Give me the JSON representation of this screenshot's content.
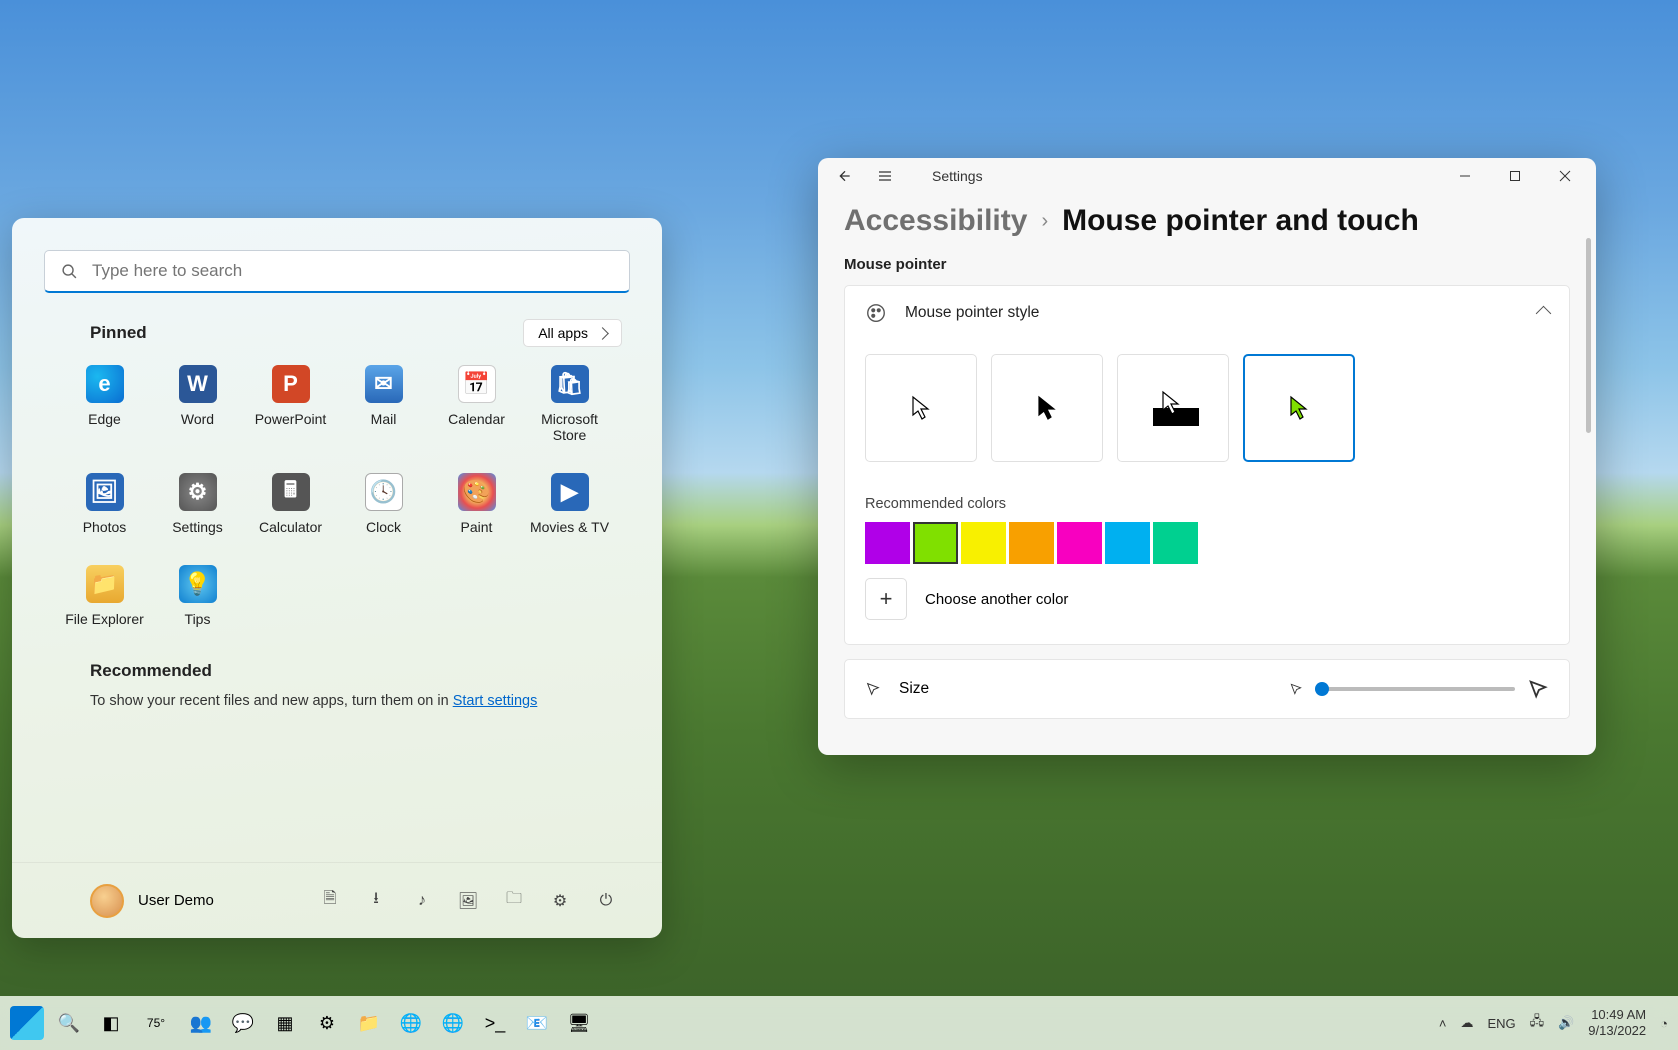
{
  "start_menu": {
    "search_placeholder": "Type here to search",
    "pinned_label": "Pinned",
    "all_apps_label": "All apps",
    "apps": [
      {
        "label": "Edge",
        "icon_class": "edge-i",
        "glyph": "e"
      },
      {
        "label": "Word",
        "icon_class": "word-i",
        "glyph": "W"
      },
      {
        "label": "PowerPoint",
        "icon_class": "ppt-i",
        "glyph": "P"
      },
      {
        "label": "Mail",
        "icon_class": "mail-i",
        "glyph": "✉"
      },
      {
        "label": "Calendar",
        "icon_class": "cal-i",
        "glyph": "📅"
      },
      {
        "label": "Microsoft Store",
        "icon_class": "store-i",
        "glyph": "🛍"
      },
      {
        "label": "Photos",
        "icon_class": "photos-i",
        "glyph": "🖼"
      },
      {
        "label": "Settings",
        "icon_class": "settings-i",
        "glyph": "⚙"
      },
      {
        "label": "Calculator",
        "icon_class": "calc-i",
        "glyph": "🖩"
      },
      {
        "label": "Clock",
        "icon_class": "clock-i",
        "glyph": "🕓"
      },
      {
        "label": "Paint",
        "icon_class": "paint-i",
        "glyph": "🎨"
      },
      {
        "label": "Movies & TV",
        "icon_class": "movies-i",
        "glyph": "▶"
      },
      {
        "label": "File Explorer",
        "icon_class": "files-i",
        "glyph": "📁"
      },
      {
        "label": "Tips",
        "icon_class": "tips-i",
        "glyph": "💡"
      }
    ],
    "recommended_label": "Recommended",
    "recommended_text": "To show your recent files and new apps, turn them on in ",
    "recommended_link": "Start settings",
    "user_name": "User Demo",
    "footer_icons": [
      "document-icon",
      "download-icon",
      "music-icon",
      "picture-icon",
      "folder-icon",
      "settings-icon",
      "power-icon"
    ]
  },
  "settings_window": {
    "app_title": "Settings",
    "breadcrumb_parent": "Accessibility",
    "breadcrumb_current": "Mouse pointer and touch",
    "section_mouse_pointer": "Mouse pointer",
    "style_header": "Mouse pointer style",
    "pointer_styles": [
      "white",
      "black",
      "inverted",
      "custom"
    ],
    "selected_style_index": 3,
    "rec_colors_label": "Recommended colors",
    "colors": [
      "#b000e8",
      "#80e000",
      "#f8f000",
      "#f8a000",
      "#f800c0",
      "#00b0f0",
      "#00d090"
    ],
    "selected_color_index": 1,
    "choose_another_label": "Choose another color",
    "size_label": "Size",
    "size_value": 1
  },
  "taskbar": {
    "apps": [
      "start",
      "search",
      "task-view",
      "weather",
      "teams",
      "chat",
      "widgets",
      "settings",
      "file-explorer",
      "edge",
      "edge-dev",
      "terminal",
      "outlook",
      "vm-connect"
    ],
    "weather_temp": "75°",
    "lang": "ENG",
    "time": "10:49 AM",
    "date": "9/13/2022"
  }
}
